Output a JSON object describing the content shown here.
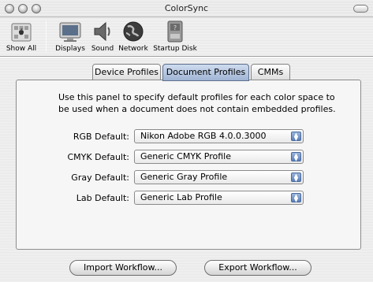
{
  "window": {
    "title": "ColorSync"
  },
  "toolbar": {
    "items": [
      {
        "label": "Show All",
        "icon": "apple-grid-icon"
      },
      {
        "label": "Displays",
        "icon": "monitor-icon"
      },
      {
        "label": "Sound",
        "icon": "speaker-icon"
      },
      {
        "label": "Network",
        "icon": "globe-icon"
      },
      {
        "label": "Startup Disk",
        "icon": "disk-icon"
      }
    ]
  },
  "tabs": [
    {
      "label": "Device Profiles"
    },
    {
      "label": "Document Profiles",
      "selected": true
    },
    {
      "label": "CMMs"
    }
  ],
  "panel": {
    "description": "Use this panel to specify default profiles for each color space to be used when a document does not contain embedded profiles.",
    "rows": [
      {
        "label": "RGB Default:",
        "value": "Nikon Adobe RGB 4.0.0.3000"
      },
      {
        "label": "CMYK Default:",
        "value": "Generic CMYK Profile"
      },
      {
        "label": "Gray Default:",
        "value": "Generic Gray Profile"
      },
      {
        "label": "Lab Default:",
        "value": "Generic Lab Profile"
      }
    ]
  },
  "buttons": {
    "import": "Import Workflow...",
    "export": "Export Workflow..."
  },
  "colors": {
    "accent": "#7a9bd0",
    "tab_selected": "#a9bddb"
  }
}
